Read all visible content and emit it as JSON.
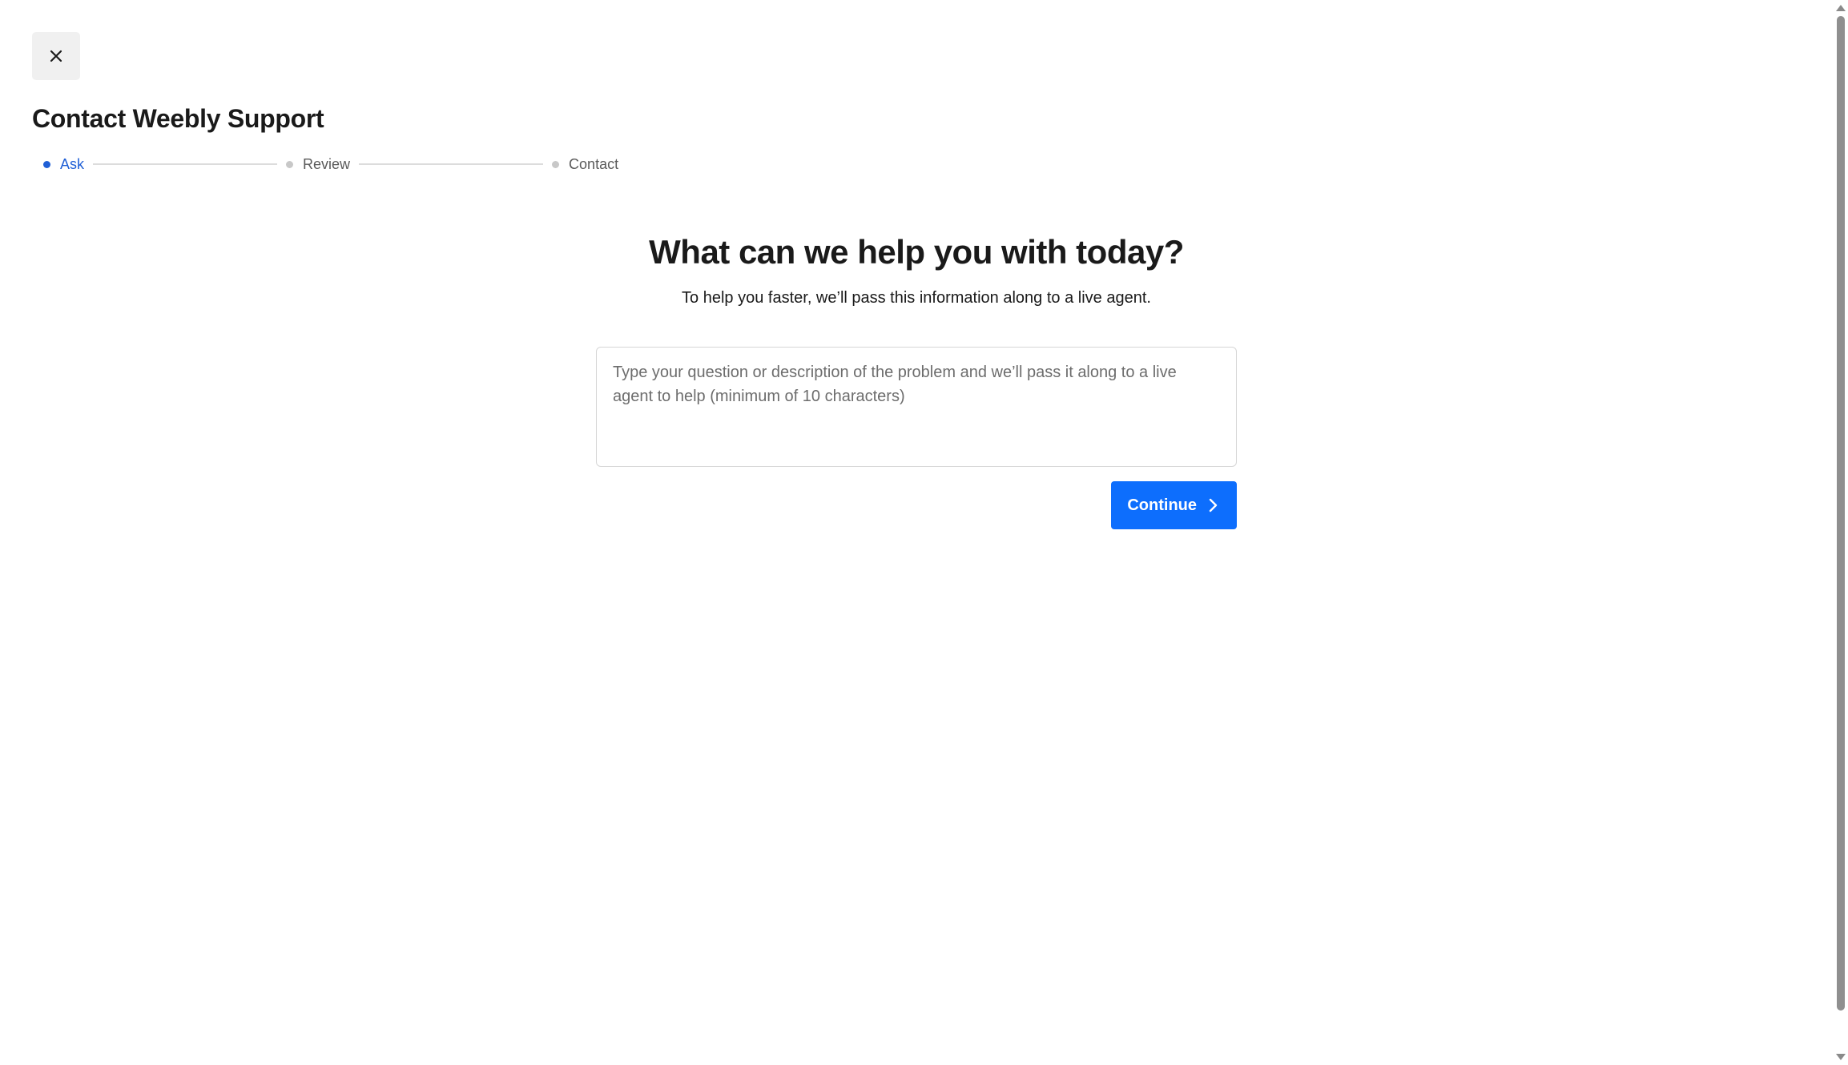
{
  "header": {
    "close_icon": "close-icon",
    "title": "Contact Weebly Support"
  },
  "stepper": {
    "steps": [
      {
        "label": "Ask",
        "state": "active"
      },
      {
        "label": "Review",
        "state": "inactive"
      },
      {
        "label": "Contact",
        "state": "inactive"
      }
    ]
  },
  "main": {
    "heading": "What can we help you with today?",
    "subtext": "To help you faster, we’ll pass this information along to a live agent.",
    "question": {
      "value": "",
      "placeholder": "Type your question or description of the problem and we’ll pass it along to a live agent to help (minimum of 10 characters)"
    },
    "continue_label": "Continue",
    "continue_icon": "chevron-right-icon"
  },
  "colors": {
    "accent": "#0d6efd",
    "active_step": "#1f5fd6",
    "inactive_step": "#c8c8c8"
  }
}
